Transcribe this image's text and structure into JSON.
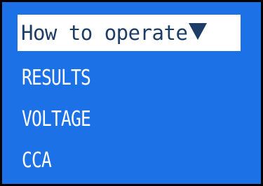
{
  "menu": {
    "header": {
      "label": "How to operate",
      "icon": "triangle-down-icon"
    },
    "items": [
      {
        "label": "RESULTS"
      },
      {
        "label": "VOLTAGE"
      },
      {
        "label": "CCA"
      }
    ]
  },
  "colors": {
    "screen_background": "#1d71e6",
    "border": "#000000",
    "header_background": "#ffffff",
    "header_text": "#1d3d66",
    "item_text": "#ffffff"
  }
}
